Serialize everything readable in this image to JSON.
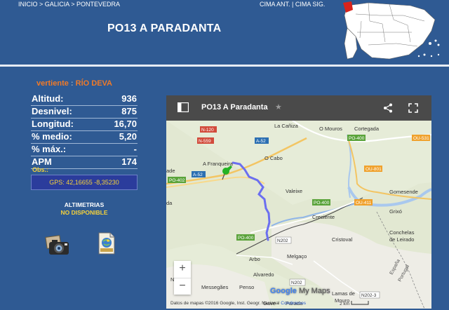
{
  "breadcrumb": {
    "text": "INICIO > GALICIA > PONTEVEDRA"
  },
  "nav": {
    "text": "CIMA ANT. | CIMA SIG."
  },
  "page": {
    "title": "PO13 A PARADANTA"
  },
  "vertiente": {
    "label": "vertiente",
    "sep": " : ",
    "river": "RÍO DEVA"
  },
  "stats": [
    {
      "label": "Altitud:",
      "value": "936"
    },
    {
      "label": "Desnivel:",
      "value": "875"
    },
    {
      "label": "Longitud:",
      "value": "16,70"
    },
    {
      "label": "% medio:",
      "value": "5,20"
    },
    {
      "label": "% máx.:",
      "value": "-"
    },
    {
      "label": "APM",
      "value": "174"
    }
  ],
  "obs": {
    "label": "Obs.:"
  },
  "gps": {
    "text": "GPS: 42,16655  -8,35230"
  },
  "altimetrias": {
    "line1": "ALTIMETRIAS",
    "line2": "NO DISPONIBLE"
  },
  "map": {
    "title": "PO13 A Paradanta",
    "labels": {
      "canica": "La Cañiza",
      "omouros": "O Mouros",
      "cortegada": "Cortegada",
      "afranqueira": "A Franqueira",
      "ocabo": "O Cabo",
      "valeixe": "Valeixe",
      "creciente": "Creciente",
      "gomesende": "Gomesende",
      "grixo": "Grixó",
      "conchelas": "Conchelas",
      "deleirado": "de Leirado",
      "cristoval": "Cristoval",
      "melgaco": "Melgaço",
      "arbo": "Arbo",
      "alvaredo": "Alvaredo",
      "nieves": "Nieves",
      "messegaes": "Messegães",
      "penso": "Penso",
      "gave": "Gave",
      "parada": "Parada",
      "lamasde": "Lamas de",
      "mouro": "Mouro",
      "espana": "España",
      "portugal": "Portugal",
      "ade": "ade",
      "da": "da"
    },
    "roads": {
      "n120": "N-120",
      "n559": "N-559",
      "a52a": "A-52",
      "a52b": "A-52",
      "po402": "PO-402",
      "po400a": "PO-400",
      "po400b": "PO-400",
      "po400c": "PO-400",
      "ou531": "OU-531",
      "ou801": "OU-801",
      "ou411": "OU-411",
      "n202a": "N202",
      "n202b": "N202",
      "n2023": "N202-3"
    },
    "googlelogo": "Google",
    "mymaps": "My Maps",
    "attribution": "Datos de mapas ©2016 Google, Inst. Geogr. Nacional",
    "conditions": "Condiciones",
    "scale": "2 km",
    "zoom_in": "+",
    "zoom_out": "−",
    "colors": {
      "land": "#e6ecd8",
      "water": "#a9c8ee",
      "track": "#6b6ff0",
      "pin": "#24b324"
    }
  }
}
